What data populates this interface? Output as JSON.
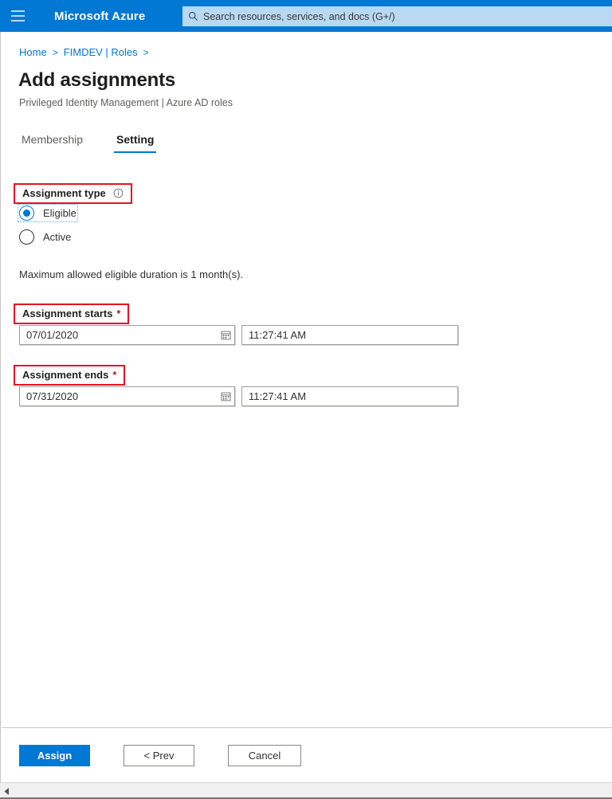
{
  "topbar": {
    "menu_icon": "hamburger-icon",
    "brand": "Microsoft Azure",
    "search_icon": "search-icon",
    "search_placeholder": "Search resources, services, and docs (G+/)",
    "bar_color": "#0078d4",
    "search_bg": "#b9d9f2"
  },
  "breadcrumb": {
    "items": [
      {
        "label": "Home"
      },
      {
        "label": "FIMDEV | Roles"
      }
    ],
    "separator": ">",
    "link_color": "#0078d4"
  },
  "header": {
    "title": "Add assignments",
    "subtitle": "Privileged Identity Management | Azure AD roles"
  },
  "tabs": [
    {
      "label": "Membership",
      "active": false
    },
    {
      "label": "Setting",
      "active": true
    }
  ],
  "form": {
    "assignment_type": {
      "label": "Assignment type",
      "info_icon": "info-icon",
      "highlight_color": "#e81123",
      "options": [
        {
          "label": "Eligible",
          "selected": true,
          "focused": true
        },
        {
          "label": "Active",
          "selected": false,
          "focused": false
        }
      ]
    },
    "note": "Maximum allowed eligible duration is 1 month(s).",
    "assignment_starts": {
      "label": "Assignment starts",
      "required_marker": "*",
      "date_value": "07/01/2020",
      "date_icon": "calendar-icon",
      "time_value": "11:27:41 AM"
    },
    "assignment_ends": {
      "label": "Assignment ends",
      "required_marker": "*",
      "date_value": "07/31/2020",
      "date_icon": "calendar-icon",
      "time_value": "11:27:41 AM"
    }
  },
  "footer": {
    "assign_label": "Assign",
    "prev_label": "< Prev",
    "cancel_label": "Cancel",
    "primary_color": "#0078d4"
  },
  "scrollbar": {
    "left_arrow_icon": "scroll-left-arrow-icon"
  }
}
